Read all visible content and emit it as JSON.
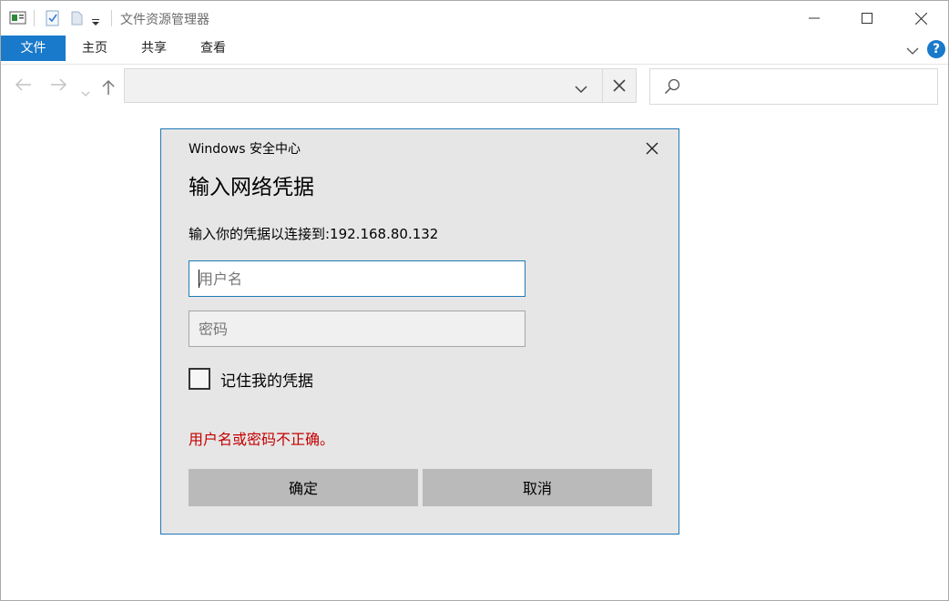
{
  "window": {
    "title": "文件资源管理器"
  },
  "ribbon": {
    "tabs": [
      "文件",
      "主页",
      "共享",
      "查看"
    ],
    "help": "?"
  },
  "search": {
    "placeholder": ""
  },
  "dialog": {
    "caption": "Windows 安全中心",
    "heading": "输入网络凭据",
    "message": "输入你的凭据以连接到:192.168.80.132",
    "username_placeholder": "用户名",
    "password_placeholder": "密码",
    "remember_label": "记住我的凭据",
    "error": "用户名或密码不正确。",
    "ok_label": "确定",
    "cancel_label": "取消"
  },
  "colors": {
    "accent": "#1979ca",
    "dialog_border": "#1f7ab8",
    "error": "#c40000"
  }
}
